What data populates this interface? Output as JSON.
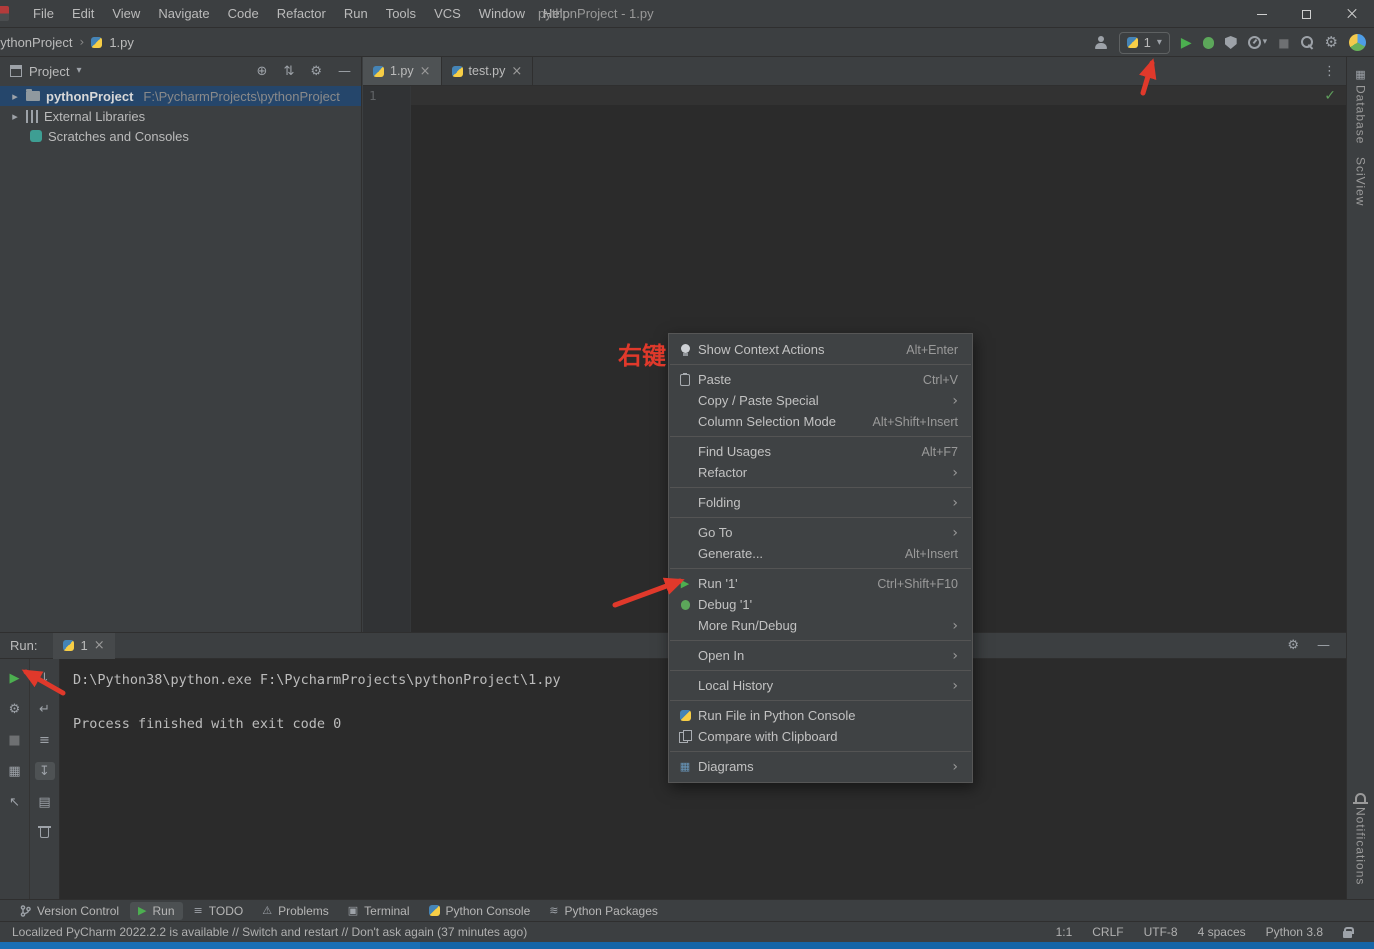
{
  "icons": {
    "play": "▶",
    "dropdown": "▾",
    "submenu": "›",
    "expand": "▸",
    "close": "×",
    "gear": "⚙",
    "minus": "—",
    "check": "✓",
    "locate": "⊕",
    "sort": "⇅",
    "more": "⋮",
    "stop": "■",
    "down": "↓",
    "pin": "↖",
    "grid": "▦",
    "lines": "≡",
    "wrap": "↵",
    "scroll_end": "↧",
    "print": "▤",
    "warning": "⚠",
    "terminal": "▣",
    "layers": "≋",
    "crumb_sep": "›"
  },
  "colors": {
    "accent_green": "#4caf50",
    "annotation_red": "#e0392b"
  },
  "title_bar": {
    "menus": [
      "File",
      "Edit",
      "View",
      "Navigate",
      "Code",
      "Refactor",
      "Run",
      "Tools",
      "VCS",
      "Window",
      "Help"
    ],
    "title": "pythonProject - 1.py"
  },
  "nav_bar": {
    "project_crumb": "pythonProject",
    "file_crumb": "1.py",
    "run_config": "1"
  },
  "project_panel": {
    "title": "Project",
    "tree": [
      {
        "label": "pythonProject",
        "path": "F:\\PycharmProjects\\pythonProject"
      },
      {
        "label": "External Libraries",
        "path": ""
      },
      {
        "label": "Scratches and Consoles",
        "path": ""
      }
    ]
  },
  "editor": {
    "tabs": [
      {
        "label": "1.py"
      },
      {
        "label": "test.py"
      }
    ],
    "line_number": "1"
  },
  "context_menu": {
    "items": [
      {
        "label": "Show Context Actions",
        "shortcut": "Alt+Enter"
      },
      {
        "label": "Paste",
        "shortcut": "Ctrl+V"
      },
      {
        "label": "Copy / Paste Special",
        "submenu": true
      },
      {
        "label": "Column Selection Mode",
        "shortcut": "Alt+Shift+Insert"
      },
      {
        "label": "Find Usages",
        "shortcut": "Alt+F7"
      },
      {
        "label": "Refactor",
        "submenu": true
      },
      {
        "label": "Folding",
        "submenu": true
      },
      {
        "label": "Go To",
        "submenu": true
      },
      {
        "label": "Generate...",
        "shortcut": "Alt+Insert"
      },
      {
        "label": "Run '1'",
        "shortcut": "Ctrl+Shift+F10"
      },
      {
        "label": "Debug '1'",
        "shortcut": ""
      },
      {
        "label": "More Run/Debug",
        "submenu": true
      },
      {
        "label": "Open In",
        "submenu": true
      },
      {
        "label": "Local History",
        "submenu": true
      },
      {
        "label": "Run File in Python Console",
        "shortcut": ""
      },
      {
        "label": "Compare with Clipboard",
        "shortcut": ""
      },
      {
        "label": "Diagrams",
        "submenu": true
      }
    ]
  },
  "run_panel": {
    "label": "Run:",
    "tab": "1",
    "console_lines": [
      "D:\\Python38\\python.exe F:\\PycharmProjects\\pythonProject\\1.py",
      "",
      "Process finished with exit code 0"
    ]
  },
  "bottom_bar": {
    "items": [
      {
        "label": "Version Control"
      },
      {
        "label": "Run"
      },
      {
        "label": "TODO"
      },
      {
        "label": "Problems"
      },
      {
        "label": "Terminal"
      },
      {
        "label": "Python Console"
      },
      {
        "label": "Python Packages"
      }
    ]
  },
  "status_bar": {
    "message": "Localized PyCharm 2022.2.2 is available // Switch and restart // Don't ask again (37 minutes ago)",
    "caret": "1:1",
    "line_ending": "CRLF",
    "encoding": "UTF-8",
    "indent": "4 spaces",
    "interpreter": "Python 3.8"
  },
  "right_strip": {
    "top_labels": [
      "Database",
      "SciView"
    ],
    "bottom_label": "Notifications"
  },
  "annotations": {
    "right_click_label": "右键"
  }
}
